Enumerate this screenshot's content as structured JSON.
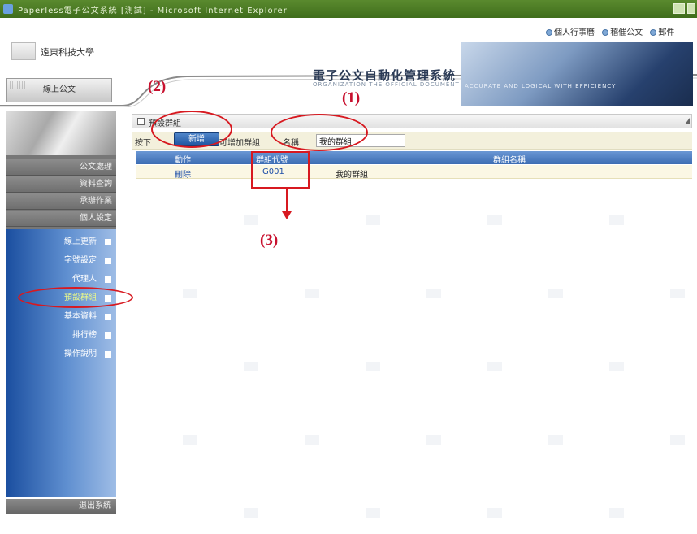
{
  "window": {
    "title": "Paperless電子公文系統 [測試] - Microsoft Internet Explorer"
  },
  "header": {
    "school_name": "遠東科技大學",
    "top_links": [
      "個人行事曆",
      "稽催公文",
      "郵件"
    ],
    "system_title": "電子公文自動化管理系統",
    "system_subtitle": "ORGANIZATION THE OFFICIAL DOCUMENT",
    "banner_tag": "ACCURATE AND LOGICAL WITH EFFICIENCY"
  },
  "sidebar": {
    "top_button": "線上公文",
    "grey_items": [
      "公文處理",
      "資料查詢",
      "承辦作業",
      "個人設定"
    ],
    "sub_items": [
      "線上更新",
      "字號設定",
      "代理人",
      "預設群組",
      "基本資料",
      "排行榜",
      "操作說明"
    ],
    "active_item": "預設群組",
    "logout": "退出系統"
  },
  "panel": {
    "title": "預設群組",
    "hint_prefix": "按下",
    "hint_suffix": "可增加群組",
    "name_label": "名稱",
    "add_button": "新增",
    "name_value": "我的群組",
    "columns": [
      "動作",
      "群組代號",
      "群組名稱"
    ],
    "rows": [
      {
        "action": "刪除",
        "code": "G001",
        "name": "我的群組"
      }
    ]
  },
  "annotations": {
    "label_1": "(1)",
    "label_2": "(2)",
    "label_3": "(3)",
    "color": "#d71920"
  }
}
